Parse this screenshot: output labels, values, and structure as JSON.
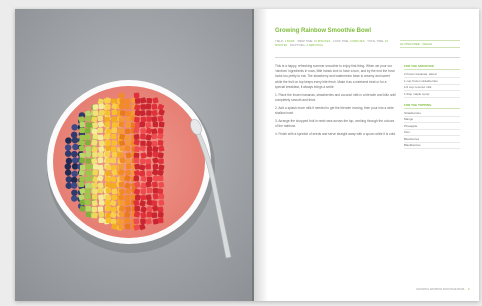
{
  "recipe": {
    "title": "Growing Rainbow Smoothie Bowl",
    "meta": [
      {
        "label": "Yield:",
        "value": "1 bowl"
      },
      {
        "label": "Prep time:",
        "value": "10 minutes"
      },
      {
        "label": "Cook time:",
        "value": "0 minutes"
      },
      {
        "label": "Total time:",
        "value": "10 minutes"
      },
      {
        "label": "Fruit/Veg:",
        "value": "4 servings"
      }
    ],
    "tagline": "Gluten-free · Vegan",
    "intro": "This is a happy, refreshing summer smoothie to enjoy first thing. When we pour our 'rainbow' ingredients in rows, little hands love to have a turn, and by the end the bowl looks too pretty to eat. The strawberry and watermelon base is creamy and sweet while the fruit on top keeps every bite fresh. Make it as a weekend treat or for a special breakfast, it always brings a smile.",
    "steps": [
      "1. Place the frozen bananas, strawberries and coconut milk in a blender and blitz until completely smooth and thick.",
      "2. Add a splash more milk if needed to get the blender moving, then pour into a wide shallow bowl.",
      "3. Arrange the chopped fruit in neat rows across the top, working through the colours of the rainbow.",
      "4. Finish with a sprinkle of seeds and serve straight away with a spoon while it is cold."
    ],
    "ingredients_heading": "For the smoothie",
    "ingredients": [
      "2 frozen bananas, sliced",
      "1 cup frozen strawberries",
      "1/2 cup coconut milk",
      "1 tbsp maple syrup"
    ],
    "topping_heading": "For the topping",
    "toppings": [
      "Strawberries",
      "Mango",
      "Pineapple",
      "Kiwi",
      "Blueberries",
      "Blackberries"
    ],
    "footer": "Growing Rainbow Smoothie Bowl",
    "page_number": "9"
  },
  "colors": {
    "accent": "#7dbb3a",
    "smoothie": "#ec8b80",
    "table": "#9b9fa3"
  }
}
